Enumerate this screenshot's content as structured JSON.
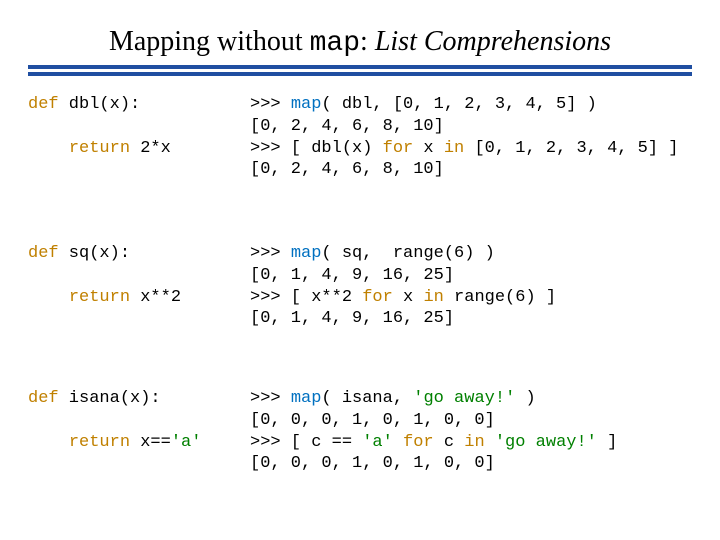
{
  "title": {
    "pre": "Mapping without ",
    "map": "map",
    "post": ": ",
    "it": "List Comprehensions"
  },
  "sec1": {
    "defline": "def dbl(x):",
    "retline": "    return 2*x",
    "r1a": ">>> map( dbl, [0, 1, 2, 3, 4, 5] )",
    "r1b": "[0, 2, 4, 6, 8, 10]",
    "r2a": ">>> [ dbl(x) for x in [0, 1, 2, 3, 4, 5] ]",
    "r2b": "[0, 2, 4, 6, 8, 10]"
  },
  "sec2": {
    "defline": "def sq(x):",
    "retline": "    return x**2",
    "r1a": ">>> map( sq,  range(6) )",
    "r1b": "[0, 1, 4, 9, 16, 25]",
    "r2a": ">>> [ x**2 for x in range(6) ]",
    "r2b": "[0, 1, 4, 9, 16, 25]"
  },
  "sec3": {
    "defline": "def isana(x):",
    "retline": "    return x=='a'",
    "r1a": ">>> map( isana, 'go away!' )",
    "r1b": "[0, 0, 0, 1, 0, 1, 0, 0]",
    "r2a": ">>> [ c == 'a' for c in 'go away!' ]",
    "r2b": "[0, 0, 0, 1, 0, 1, 0, 0]"
  }
}
